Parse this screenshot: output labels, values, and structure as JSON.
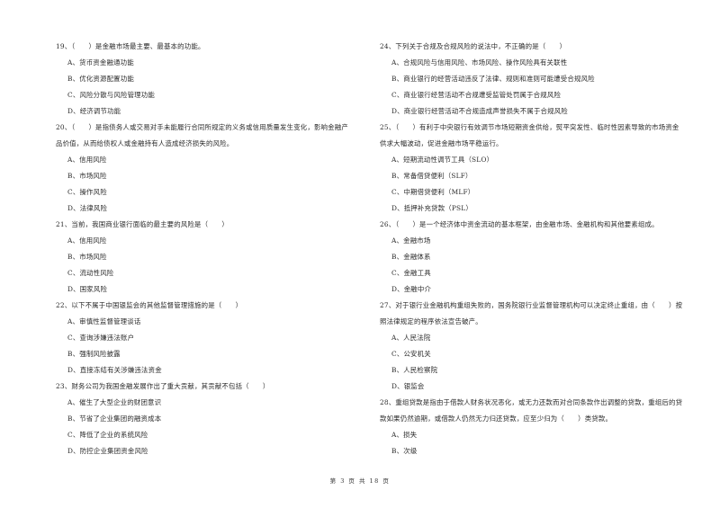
{
  "left_column": [
    {
      "stem": "19、（　　）是金融市场最主要、最基本的功能。",
      "options": [
        "A、货币资金融通功能",
        "B、优化资源配置功能",
        "C、风险分散与风险管理功能",
        "D、经济调节功能"
      ]
    },
    {
      "stem": "20、（　　）是指债务人或交易对手未能履行合同所规定的义务或信用质量发生变化，影响金融产品价值，从而给债权人或金融持有人造成经济损失的风险。",
      "options": [
        "A、信用风险",
        "B、市场风险",
        "C、操作风险",
        "D、法律风险"
      ]
    },
    {
      "stem": "21、当前，我国商业银行面临的最主要的风险是（　　）",
      "options": [
        "A、信用风险",
        "B、市场风险",
        "C、流动性风险",
        "D、国家风险"
      ]
    },
    {
      "stem": "22、以下不属于中国银监会的其他监督管理措施的是（　　）",
      "options": [
        "A、审慎性监督管理谈话",
        "C、查询涉嫌违法账户",
        "B、强制风险披露",
        "D、直接冻结有关涉嫌违法资金"
      ]
    },
    {
      "stem": "23、财务公司为我国金融发展作出了重大贡献，其贡献不包括（　　）",
      "options": [
        "A、催生了大型企业的财团意识",
        "B、节省了企业集团的融资成本",
        "C、降低了企业的系统风险",
        "D、防控企业集团资金风险"
      ]
    }
  ],
  "right_column": [
    {
      "stem": "24、下列关于合规及合规风险的说法中，不正确的是（　　）",
      "options": [
        "A、合规风险与信用风险、市场风险、操作风险具有关联性",
        "B、商业银行的经营活动违反了法律、规则和准则可能遭受合规风险",
        "C、商业银行经营活动不合规遭受监管处罚属于合规风险",
        "D、商业银行经营活动不合规造成声誉损失不属于合规风险"
      ]
    },
    {
      "stem": "25、（　　）有利于中央银行有效调节市场短期资金供给，熨平突发性、临时性因素导致的市场资金供求大幅波动，促进金融市场平稳运行。",
      "options": [
        "A、短期流动性调节工具（SLO）",
        "B、常备借贷便利（SLF）",
        "C、中期借贷便利（MLF）",
        "D、抵押补充贷款（PSL）"
      ]
    },
    {
      "stem": "26、（　　）是一个经济体中资金流动的基本框架，由金融市场、金融机构和其他要素组成。",
      "options": [
        "A、金融市场",
        "B、金融体系",
        "C、金融工具",
        "D、金融中介"
      ]
    },
    {
      "stem": "27、对于银行业金融机构重组失败的，国务院银行业监督管理机构可以决定终止重组，由（　　）按照法律规定的程序依法宣告破产。",
      "options": [
        "A、人民法院",
        "C、公安机关",
        "B、人民检察院",
        "D、银监会"
      ]
    },
    {
      "stem": "28、重组贷款是指由于借款人财务状况恶化，或无力还款而对合同条款作出调整的贷款，重组后的贷款如果仍然逾期，或借款人仍然无力归还贷款，应至少归为（　　）类贷款。",
      "options": [
        "A、损失",
        "B、次级"
      ]
    }
  ],
  "footer": {
    "page_label": "第 3 页 共 18 页"
  }
}
